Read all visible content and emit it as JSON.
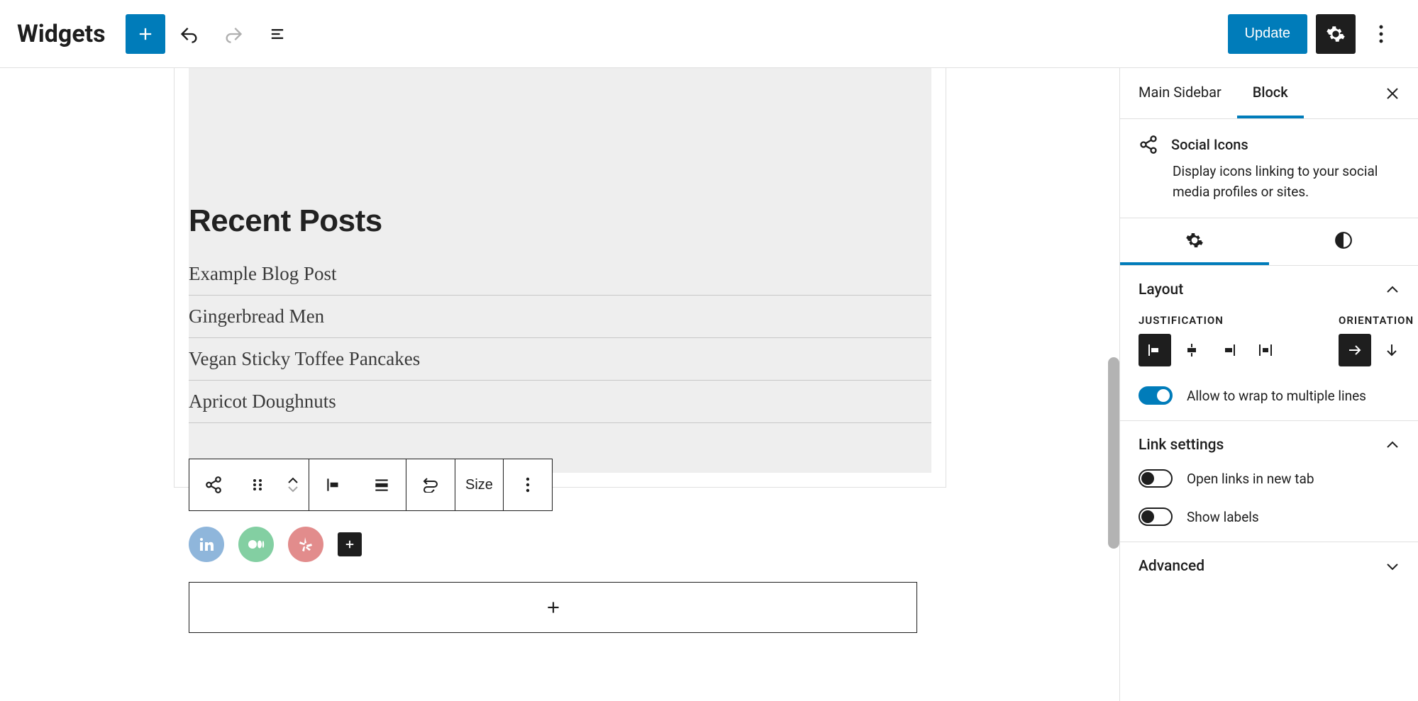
{
  "topbar": {
    "title": "Widgets",
    "update_label": "Update"
  },
  "editor": {
    "recent_posts_heading": "Recent Posts",
    "posts": [
      "Example Blog Post",
      "Gingerbread Men",
      "Vegan Sticky Toffee Pancakes",
      "Apricot Doughnuts"
    ]
  },
  "block_toolbar": {
    "size_label": "Size"
  },
  "social_icons": [
    "linkedin",
    "medium",
    "yelp"
  ],
  "sidebar": {
    "tabs": {
      "main": "Main Sidebar",
      "block": "Block"
    },
    "block_info": {
      "title": "Social Icons",
      "description": "Display icons linking to your social media profiles or sites."
    },
    "panels": {
      "layout": {
        "title": "Layout",
        "justification_label": "JUSTIFICATION",
        "orientation_label": "ORIENTATION",
        "wrap_label": "Allow to wrap to multiple lines",
        "wrap_enabled": true
      },
      "link_settings": {
        "title": "Link settings",
        "new_tab_label": "Open links in new tab",
        "new_tab_enabled": false,
        "show_labels_label": "Show labels",
        "show_labels_enabled": false
      },
      "advanced": {
        "title": "Advanced"
      }
    }
  }
}
